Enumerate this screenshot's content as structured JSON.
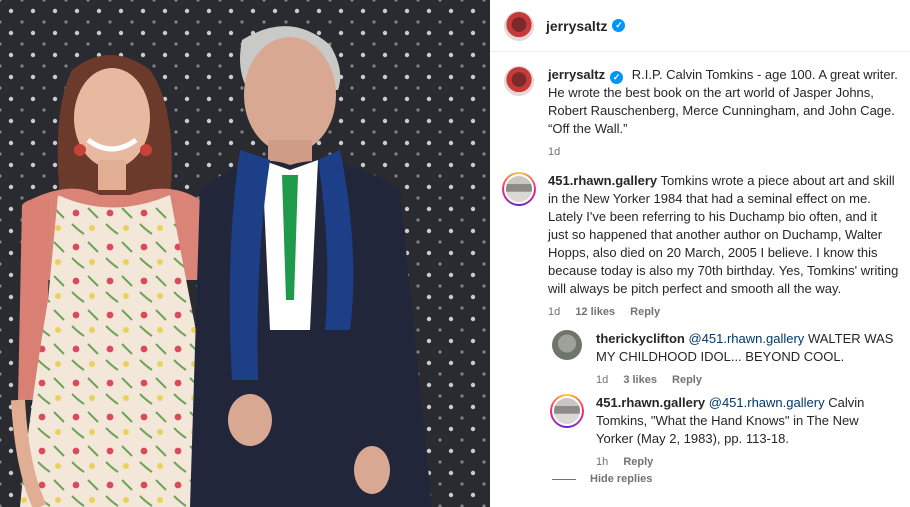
{
  "post": {
    "username": "jerrysaltz",
    "verified_mark": "✓"
  },
  "caption": {
    "username": "jerrysaltz",
    "text": "R.I.P. Calvin Tomkins - age 100. A great writer. He wrote the best book on the art world of Jasper Johns, Robert Rauschenberg, Merce Cunningham, and John Cage. “Off the Wall.”",
    "time": "1d"
  },
  "comments": [
    {
      "username": "451.rhawn.gallery",
      "text": "Tomkins wrote a piece about art and skill in the New Yorker 1984 that had a seminal effect on me. Lately I've been referring to his Duchamp bio often, and it just so happened that another author on Duchamp, Walter Hopps, also died on 20 March, 2005 I believe. I know this because today is also my 70th birthday. Yes, Tomkins' writing will always be pitch perfect and smooth all the way.",
      "time": "1d",
      "likes": "12 likes",
      "reply": "Reply"
    },
    {
      "username": "therickyclifton",
      "mention": "@451.rhawn.gallery",
      "text": "WALTER WAS MY CHILDHOOD IDOL... BEYOND COOL.",
      "time": "1d",
      "likes": "3 likes",
      "reply": "Reply"
    },
    {
      "username": "451.rhawn.gallery",
      "mention": "@451.rhawn.gallery",
      "text": "Calvin Tomkins, \"What the Hand Knows\" in The New Yorker (May 2, 1983), pp. 113-18.",
      "time": "1h",
      "reply": "Reply"
    }
  ],
  "hide_replies": "Hide replies",
  "colors": {
    "link": "#00376b",
    "verified": "#0095f6",
    "muted": "#737373"
  }
}
